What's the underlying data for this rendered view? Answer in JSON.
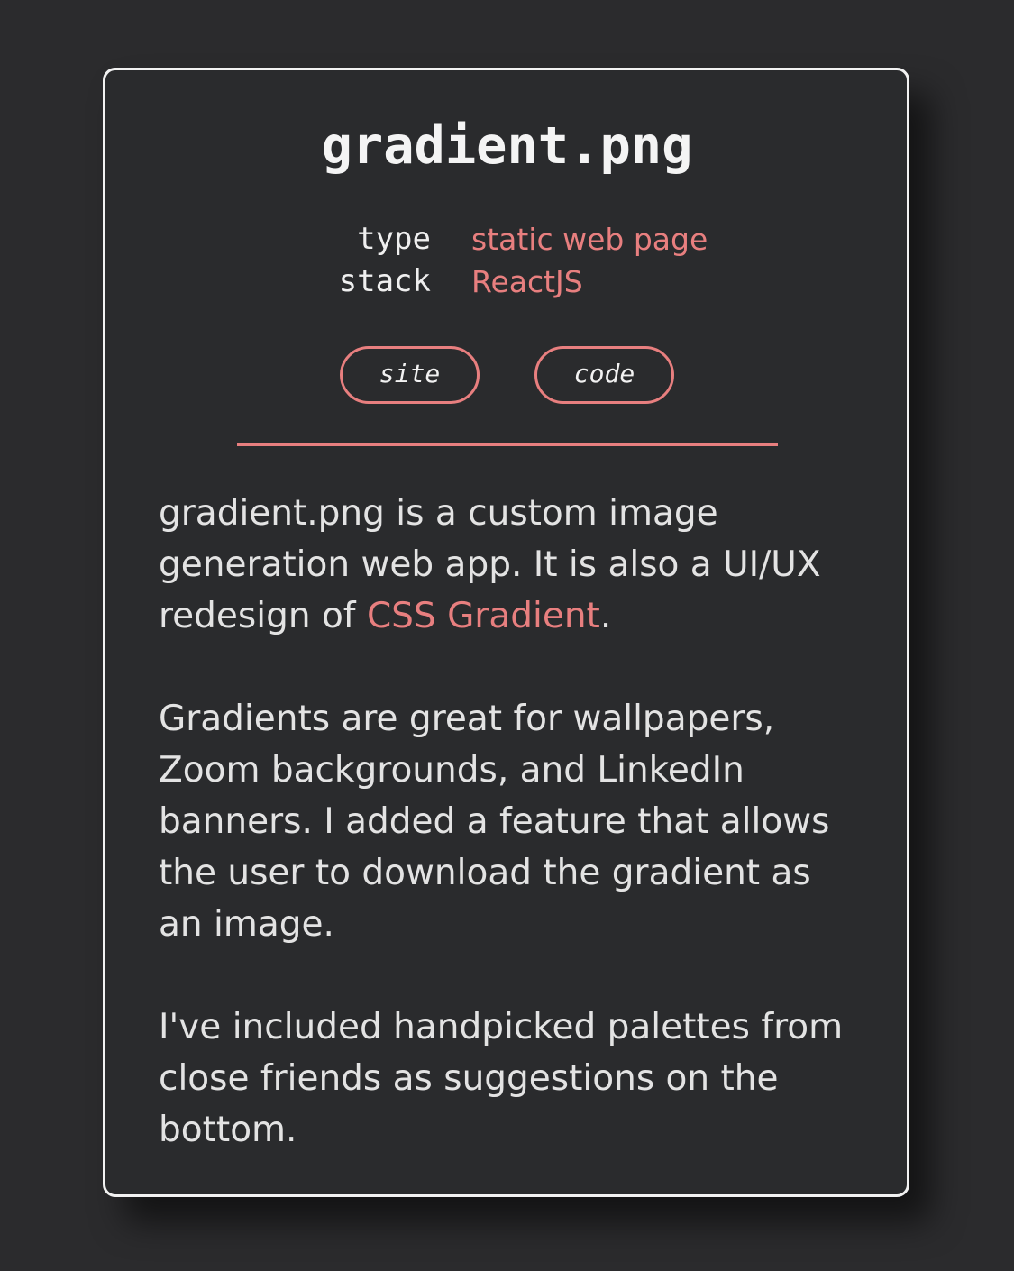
{
  "project": {
    "title": "gradient.png",
    "meta": [
      {
        "key": "type",
        "value": "static web page"
      },
      {
        "key": "stack",
        "value": "ReactJS"
      }
    ],
    "buttons": {
      "site": "site",
      "code": "code"
    },
    "description": {
      "p1_before": "gradient.png is a custom image generation web app. It is also a UI/UX redesign of ",
      "p1_link": "CSS Gradient",
      "p1_after": ".",
      "p2": "Gradients are great for wallpapers, Zoom backgrounds, and LinkedIn banners. I added a feature that allows the user to download the gradient as an image.",
      "p3": "I've included handpicked palettes from close friends as suggestions on the bottom."
    }
  },
  "colors": {
    "background": "#2b2b2d",
    "card": "#2a2b2d",
    "border": "#f2f2f2",
    "accent": "#e87f7f",
    "text": "#e3e3e3"
  }
}
